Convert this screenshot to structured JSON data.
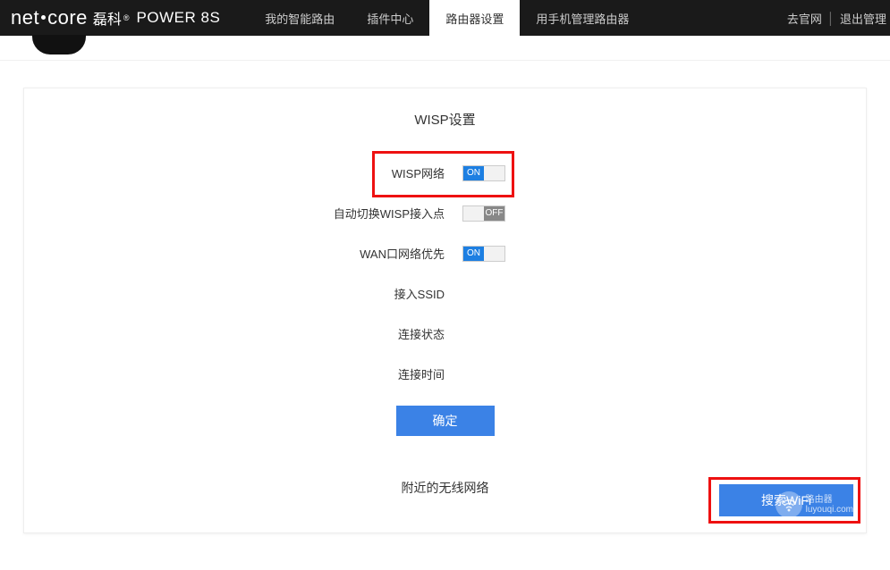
{
  "header": {
    "brand_left": "net",
    "brand_right": "core",
    "brand_cn": "磊科",
    "brand_model": "POWER 8S",
    "nav": [
      "我的智能路由",
      "插件中心",
      "路由器设置",
      "用手机管理路由器"
    ],
    "nav_active": 2,
    "right_a": "去官网",
    "right_b": "退出管理"
  },
  "panel": {
    "title": "WISP设置",
    "rows": [
      {
        "label": "WISP网络",
        "ctrl": "toggle",
        "state": "on"
      },
      {
        "label": "自动切换WISP接入点",
        "ctrl": "toggle",
        "state": "off"
      },
      {
        "label": "WAN口网络优先",
        "ctrl": "toggle",
        "state": "on"
      },
      {
        "label": "接入SSID",
        "ctrl": "text",
        "value": ""
      },
      {
        "label": "连接状态",
        "ctrl": "text",
        "value": ""
      },
      {
        "label": "连接时间",
        "ctrl": "text",
        "value": ""
      }
    ],
    "toggle_on_text": "ON",
    "toggle_off_text": "OFF",
    "confirm": "确定",
    "subhead": "附近的无线网络",
    "search": "搜索WiFi"
  },
  "watermark": {
    "line1": "路由器",
    "line2": "luyouqi.com"
  }
}
